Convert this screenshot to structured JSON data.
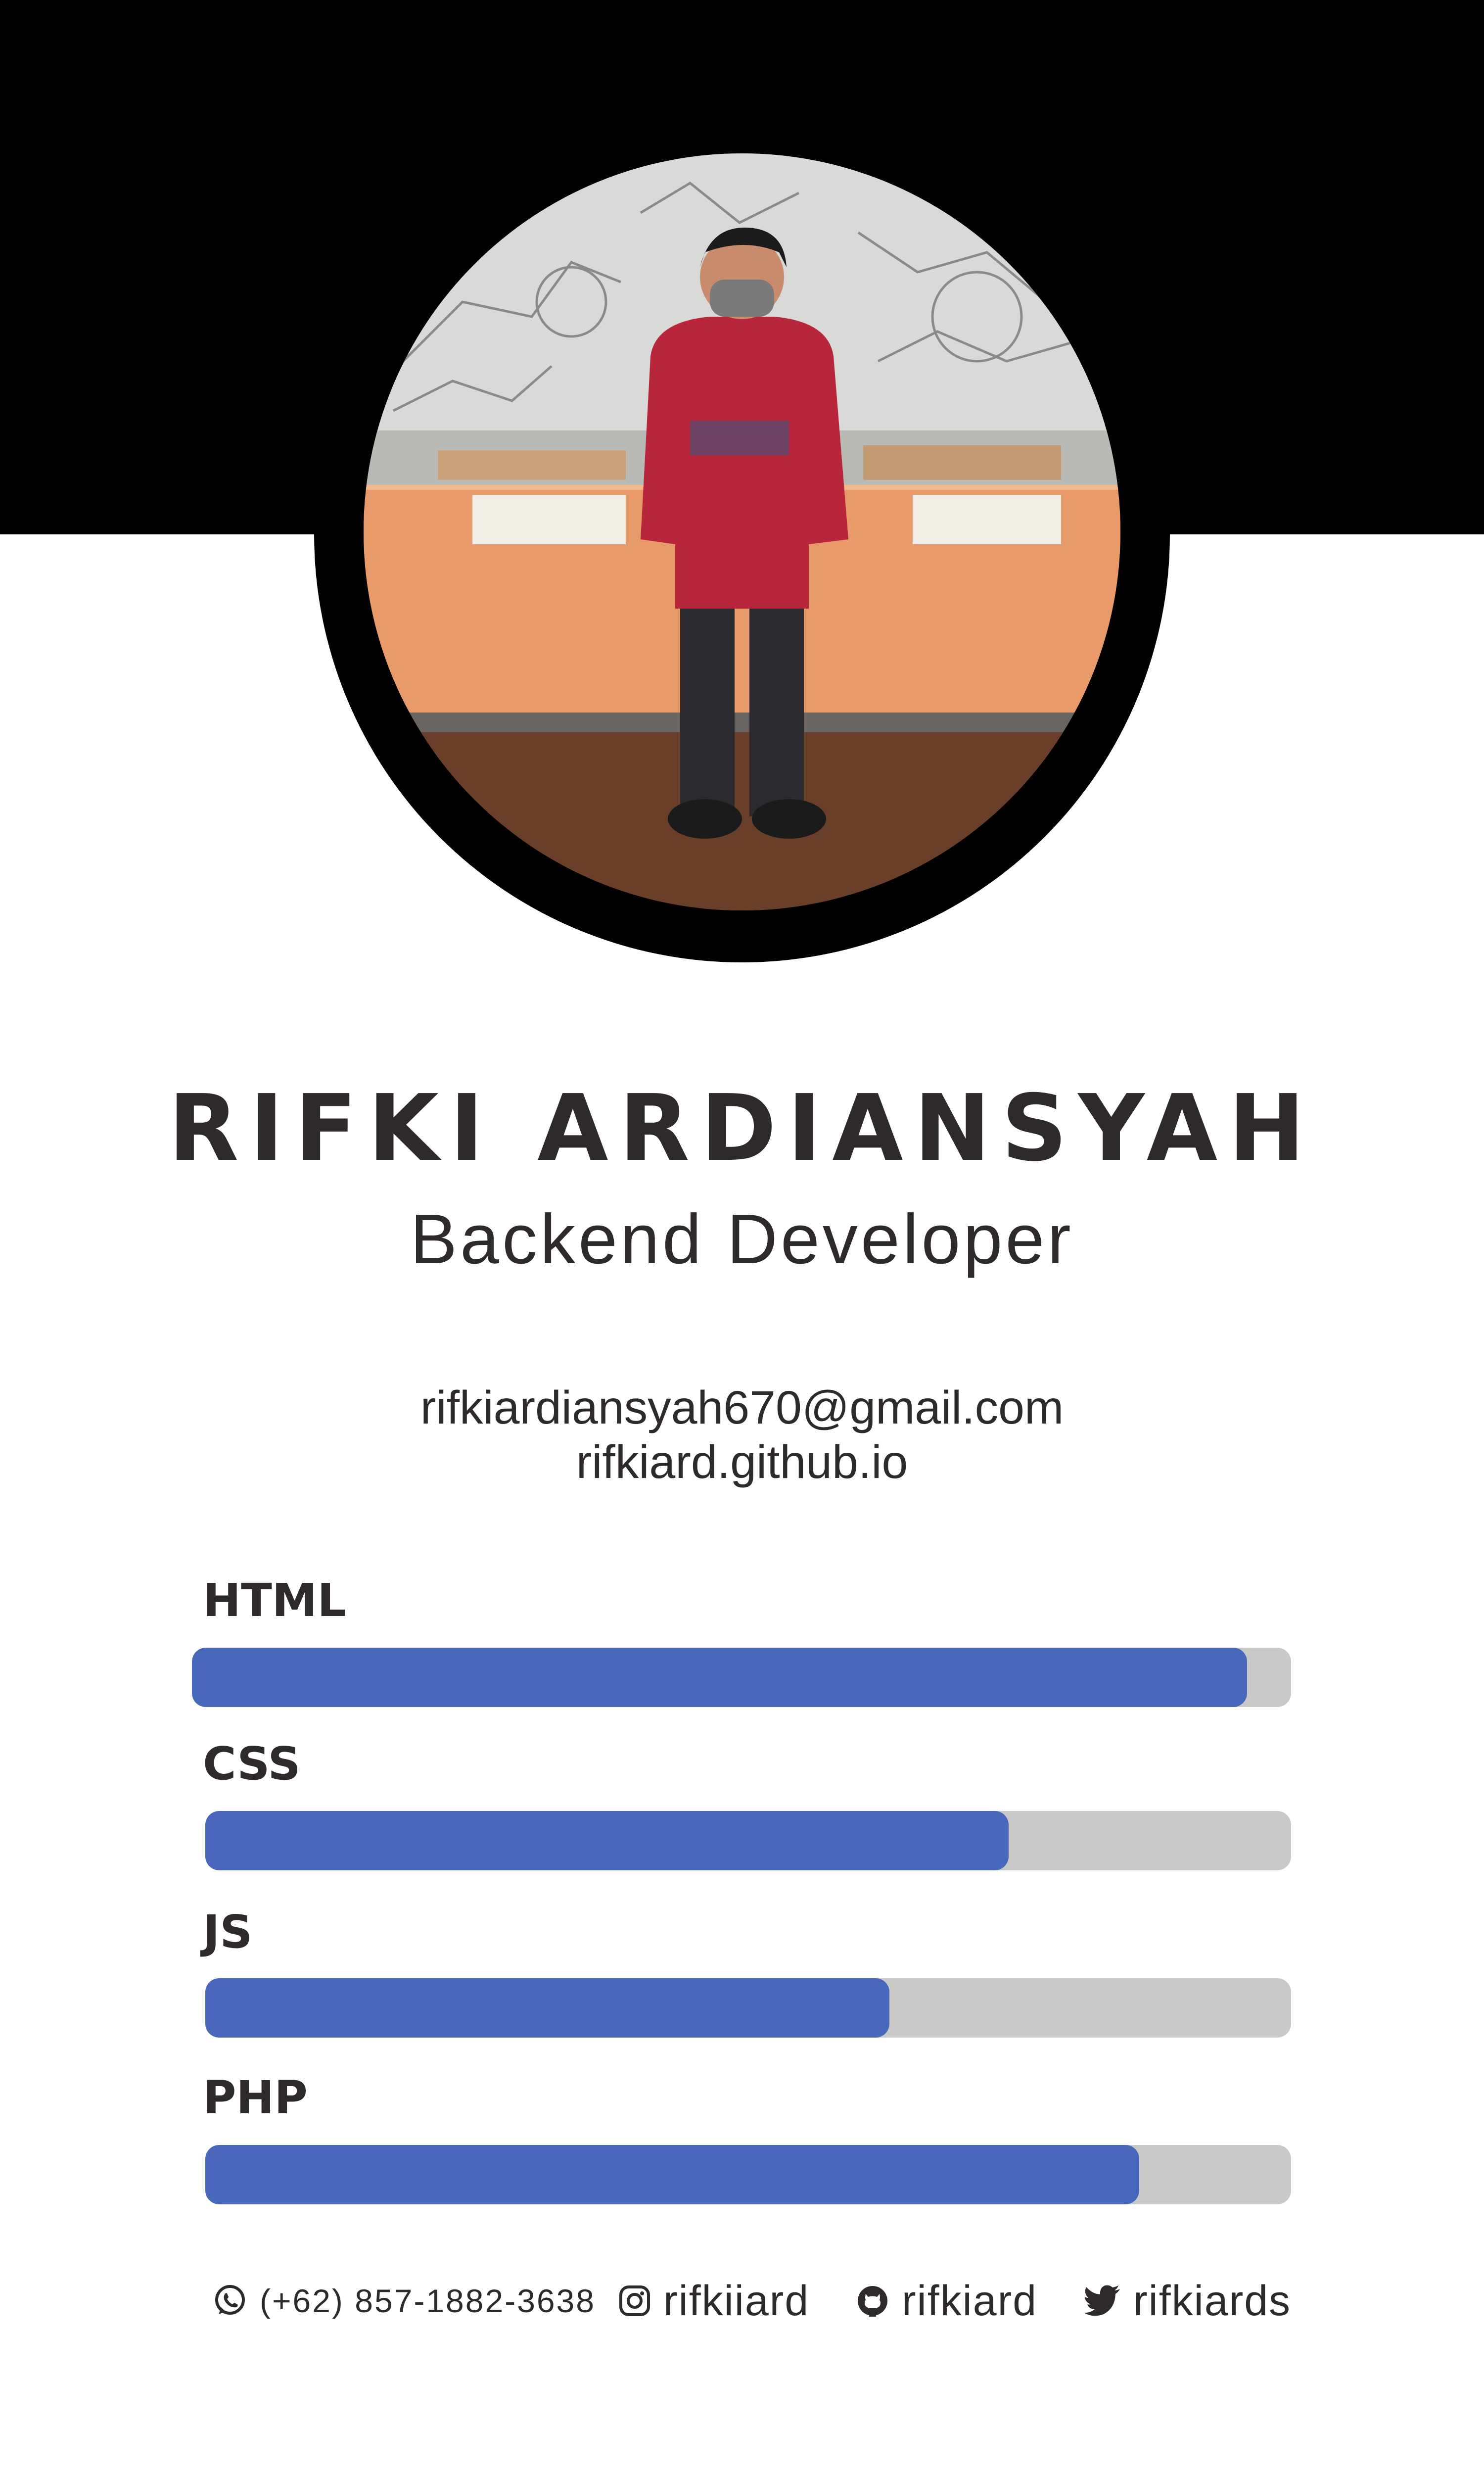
{
  "profile": {
    "name": "RIFKI ARDIANSYAH",
    "title": "Backend Developer",
    "email": "rifkiardiansyah670@gmail.com",
    "website": "rifkiard.github.io"
  },
  "skills": [
    {
      "label": "HTML",
      "level": 0.96
    },
    {
      "label": "CSS",
      "level": 0.74
    },
    {
      "label": "JS",
      "level": 0.63
    },
    {
      "label": "PHP",
      "level": 0.86
    }
  ],
  "social": {
    "phone": "(+62) 857-1882-3638",
    "instagram": "rifkiiard",
    "github": "rifkiard",
    "twitter": "rifkiards"
  },
  "colors": {
    "header": "#000000",
    "bar_fill": "#4a68bb",
    "bar_track": "#c9c9c9",
    "text": "#2e2a2a"
  },
  "icons": {
    "phone": "whatsapp-icon",
    "instagram": "instagram-icon",
    "github": "github-icon",
    "twitter": "twitter-icon"
  }
}
